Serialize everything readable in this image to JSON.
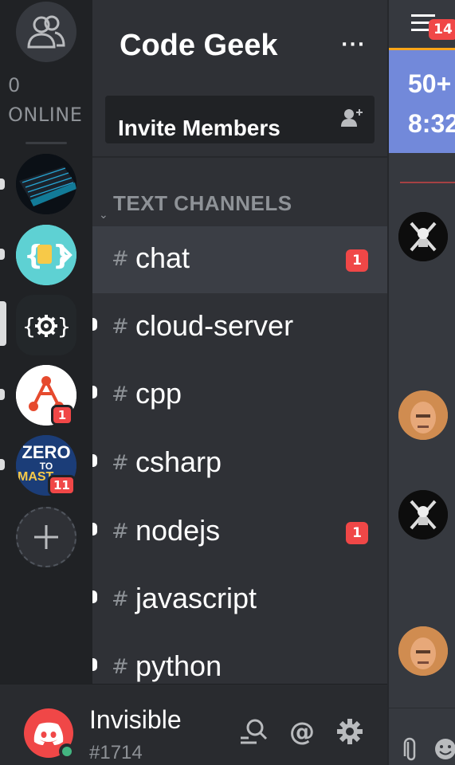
{
  "rail": {
    "online_count": "0",
    "online_label": "ONLINE",
    "servers": [
      {
        "name": "keyboard-server"
      },
      {
        "name": "code-brackets-server"
      },
      {
        "name": "code-geek-server",
        "selected": true
      },
      {
        "name": "triangle-server",
        "badge": "1"
      },
      {
        "name": "zero-to-mastery-server",
        "badge": "11",
        "logo_text": [
          "ZERO",
          "TO",
          "MAST"
        ]
      }
    ]
  },
  "server": {
    "name": "Code Geek",
    "more_label": "···",
    "invite_label": "Invite Members",
    "category": "TEXT CHANNELS",
    "channels": [
      {
        "name": "chat",
        "badge": "1",
        "active": true
      },
      {
        "name": "cloud-server"
      },
      {
        "name": "cpp"
      },
      {
        "name": "csharp"
      },
      {
        "name": "nodejs",
        "badge": "1"
      },
      {
        "name": "javascript"
      },
      {
        "name": "python"
      }
    ]
  },
  "user": {
    "status": "Invisible",
    "tag": "#1714"
  },
  "chat": {
    "badge": "14",
    "banner_line1": "50+",
    "banner_line2": "8:32"
  },
  "icons": {
    "hash": "#",
    "add": "+"
  },
  "colors": {
    "blurple": "#7289da",
    "red": "#f04747",
    "green": "#43b581",
    "orange": "#faa61a"
  }
}
